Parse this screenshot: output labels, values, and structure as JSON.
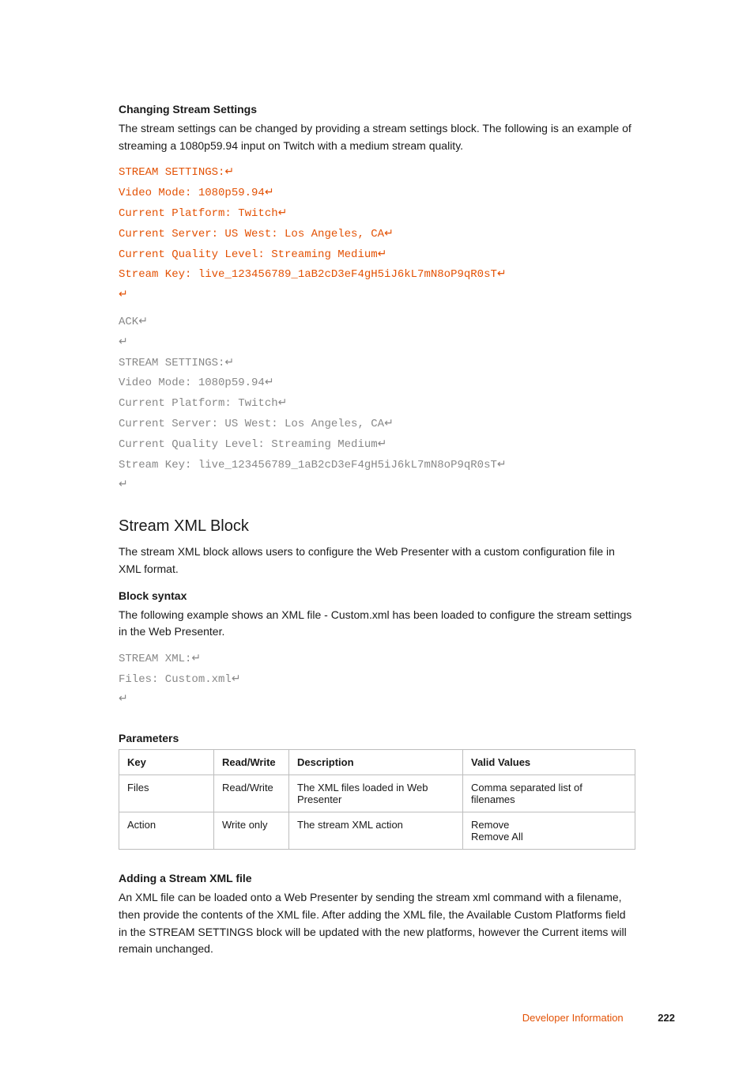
{
  "section1": {
    "heading": "Changing Stream Settings",
    "paragraph": "The stream settings can be changed by providing a stream settings block. The following is an example of streaming a 1080p59.94 input on Twitch with a medium stream quality.",
    "code_orange": {
      "l0": "STREAM SETTINGS:",
      "l1": "Video Mode: 1080p59.94",
      "l2": "Current Platform: Twitch",
      "l3": "Current Server: US West: Los Angeles, CA",
      "l4": "Current Quality Level: Streaming Medium",
      "l5": "Stream Key: live_123456789_1aB2cD3eF4gH5iJ6kL7mN8oP9qR0sT"
    },
    "code_gray": {
      "l0": "ACK",
      "l1": "",
      "l2": "STREAM SETTINGS:",
      "l3": "Video Mode: 1080p59.94",
      "l4": "Current Platform: Twitch",
      "l5": "Current Server: US West: Los Angeles, CA",
      "l6": "Current Quality Level: Streaming Medium",
      "l7": "Stream Key: live_123456789_1aB2cD3eF4gH5iJ6kL7mN8oP9qR0sT"
    }
  },
  "section2": {
    "title": "Stream XML Block",
    "intro": "The stream XML block allows users to configure the Web Presenter with a custom configuration file in XML format.",
    "block_syntax_heading": "Block syntax",
    "block_syntax_para": "The following example shows an XML file - Custom.xml has been loaded to configure the stream settings in the Web Presenter.",
    "code": {
      "l0": "STREAM XML:",
      "l1": "Files: Custom.xml"
    },
    "parameters_heading": "Parameters",
    "table": {
      "h0": "Key",
      "h1": "Read/Write",
      "h2": "Description",
      "h3": "Valid Values",
      "r0c0": "Files",
      "r0c1": "Read/Write",
      "r0c2": "The XML files loaded in Web Presenter",
      "r0c3": "Comma separated list of filenames",
      "r1c0": "Action",
      "r1c1": "Write only",
      "r1c2": "The stream XML action",
      "r1c3a": "Remove",
      "r1c3b": "Remove All"
    },
    "adding_heading": "Adding a Stream XML file",
    "adding_para": "An XML file can be loaded onto a Web Presenter by sending the stream xml command with a filename, then provide the contents of the XML file. After adding the XML file, the Available Custom Platforms field in the STREAM SETTINGS block will be updated with the new platforms, however the Current items will remain unchanged."
  },
  "footer": {
    "label": "Developer Information",
    "page": "222"
  }
}
